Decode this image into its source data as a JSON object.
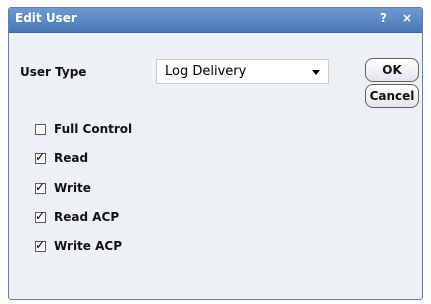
{
  "window": {
    "title": "Edit User",
    "help_glyph": "?",
    "close_glyph": "×"
  },
  "user_type": {
    "label": "User Type",
    "selected": "Log Delivery"
  },
  "buttons": {
    "ok": "OK",
    "cancel": "Cancel"
  },
  "permissions": [
    {
      "label": "Full Control",
      "checked": false
    },
    {
      "label": "Read",
      "checked": true
    },
    {
      "label": "Write",
      "checked": true
    },
    {
      "label": "Read ACP",
      "checked": true
    },
    {
      "label": "Write ACP",
      "checked": true
    }
  ]
}
